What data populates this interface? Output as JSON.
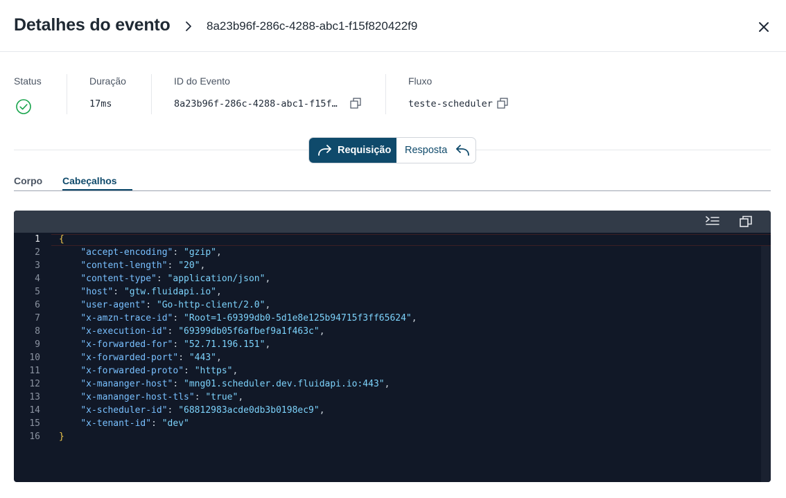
{
  "header": {
    "title": "Detalhes do evento",
    "event_id": "8a23b96f-286c-4288-abc1-f15f820422f9"
  },
  "meta": {
    "status_label": "Status",
    "duration_label": "Duração",
    "duration_value": "17ms",
    "event_id_label": "ID do Evento",
    "event_id_value": "8a23b96f-286c-4288-abc1-f15f…",
    "flow_label": "Fluxo",
    "flow_value": "teste-scheduler"
  },
  "toggle": {
    "request_label": "Requisição",
    "response_label": "Resposta"
  },
  "tabs": {
    "body": "Corpo",
    "headers": "Cabeçalhos"
  },
  "code": {
    "open_brace": "{",
    "close_brace": "}",
    "entries": [
      {
        "key": "\"accept-encoding\"",
        "value": "\"gzip\""
      },
      {
        "key": "\"content-length\"",
        "value": "\"20\""
      },
      {
        "key": "\"content-type\"",
        "value": "\"application/json\""
      },
      {
        "key": "\"host\"",
        "value": "\"gtw.fluidapi.io\""
      },
      {
        "key": "\"user-agent\"",
        "value": "\"Go-http-client/2.0\""
      },
      {
        "key": "\"x-amzn-trace-id\"",
        "value": "\"Root=1-69399db0-5d1e8e125b94715f3ff65624\""
      },
      {
        "key": "\"x-execution-id\"",
        "value": "\"69399db05f6afbef9a1f463c\""
      },
      {
        "key": "\"x-forwarded-for\"",
        "value": "\"52.71.196.151\""
      },
      {
        "key": "\"x-forwarded-port\"",
        "value": "\"443\""
      },
      {
        "key": "\"x-forwarded-proto\"",
        "value": "\"https\""
      },
      {
        "key": "\"x-mananger-host\"",
        "value": "\"mng01.scheduler.dev.fluidapi.io:443\""
      },
      {
        "key": "\"x-mananger-host-tls\"",
        "value": "\"true\""
      },
      {
        "key": "\"x-scheduler-id\"",
        "value": "\"68812983acde0db3b0198ec9\""
      },
      {
        "key": "\"x-tenant-id\"",
        "value": "\"dev\""
      }
    ]
  },
  "line_numbers": [
    "1",
    "2",
    "3",
    "4",
    "5",
    "6",
    "7",
    "8",
    "9",
    "10",
    "11",
    "12",
    "13",
    "14",
    "15",
    "16"
  ],
  "colors": {
    "accent": "#0f4a6b",
    "success": "#16a34a",
    "editor_bg": "#111827",
    "editor_toolbar": "#323b48"
  },
  "icons": {
    "breadcrumb": "chevron-right-icon",
    "close": "close-icon",
    "status": "check-circle-icon",
    "copy": "copy-icon",
    "request": "redo-arrow-icon",
    "response": "reply-arrow-icon",
    "format": "format-indent-icon"
  }
}
